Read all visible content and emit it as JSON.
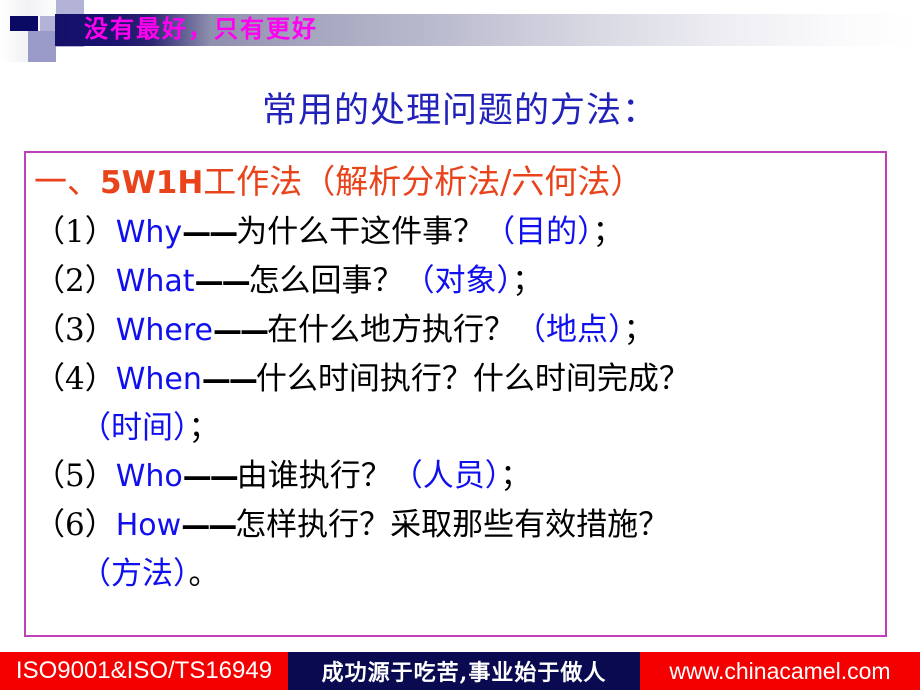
{
  "banner": {
    "title": "没有最好，只有更好",
    "title_color": "#ff00f0",
    "bar_start_color": "#13106a",
    "square_navy_color": "#0a0a64",
    "square_lilac_color": "#b3b3d7"
  },
  "page_title": {
    "text": "常用的处理问题的方法：",
    "color": "#2222bb"
  },
  "content": {
    "border_color": "#c040b8",
    "heading": {
      "prefix": "一、",
      "bold_en": "5W1H",
      "suffix": "工作法（解析分析法/六何法）",
      "color": "#e8431a"
    },
    "items": [
      {
        "number": "（1）",
        "english": "Why",
        "dash": "——",
        "question": "为什么干这件事？",
        "note": "（目的）",
        "punct": "；"
      },
      {
        "number": "（2）",
        "english": "What",
        "dash": "——",
        "question": "怎么回事？",
        "note": "（对象）",
        "punct": "；"
      },
      {
        "number": "（3）",
        "english": "Where",
        "dash": "——",
        "question": "在什么地方执行？",
        "note": "（地点）",
        "punct": "；"
      },
      {
        "number": "（4）",
        "english": "When",
        "dash": "——",
        "question": "什么时间执行？什么时间完成？",
        "note": "",
        "punct": "",
        "continuation_note": "（时间）",
        "continuation_punct": "；"
      },
      {
        "number": "（5）",
        "english": "Who",
        "dash": "——",
        "question": "由谁执行？",
        "note": "（人员）",
        "punct": "；"
      },
      {
        "number": "（6）",
        "english": "How",
        "dash": "——",
        "question": "怎样执行？采取那些有效措施？",
        "note": "",
        "punct": "",
        "continuation_note": "（方法）",
        "continuation_punct": "。"
      }
    ],
    "english_color": "#1010ee",
    "note_color": "#1010ee"
  },
  "footer": {
    "left_text": "ISO9001&ISO/TS16949",
    "middle_text": "成功源于吃苦,事业始于做人",
    "right_text": "www.chinacamel.com",
    "red_color": "#f40000",
    "navy_color": "#0a0a50"
  }
}
